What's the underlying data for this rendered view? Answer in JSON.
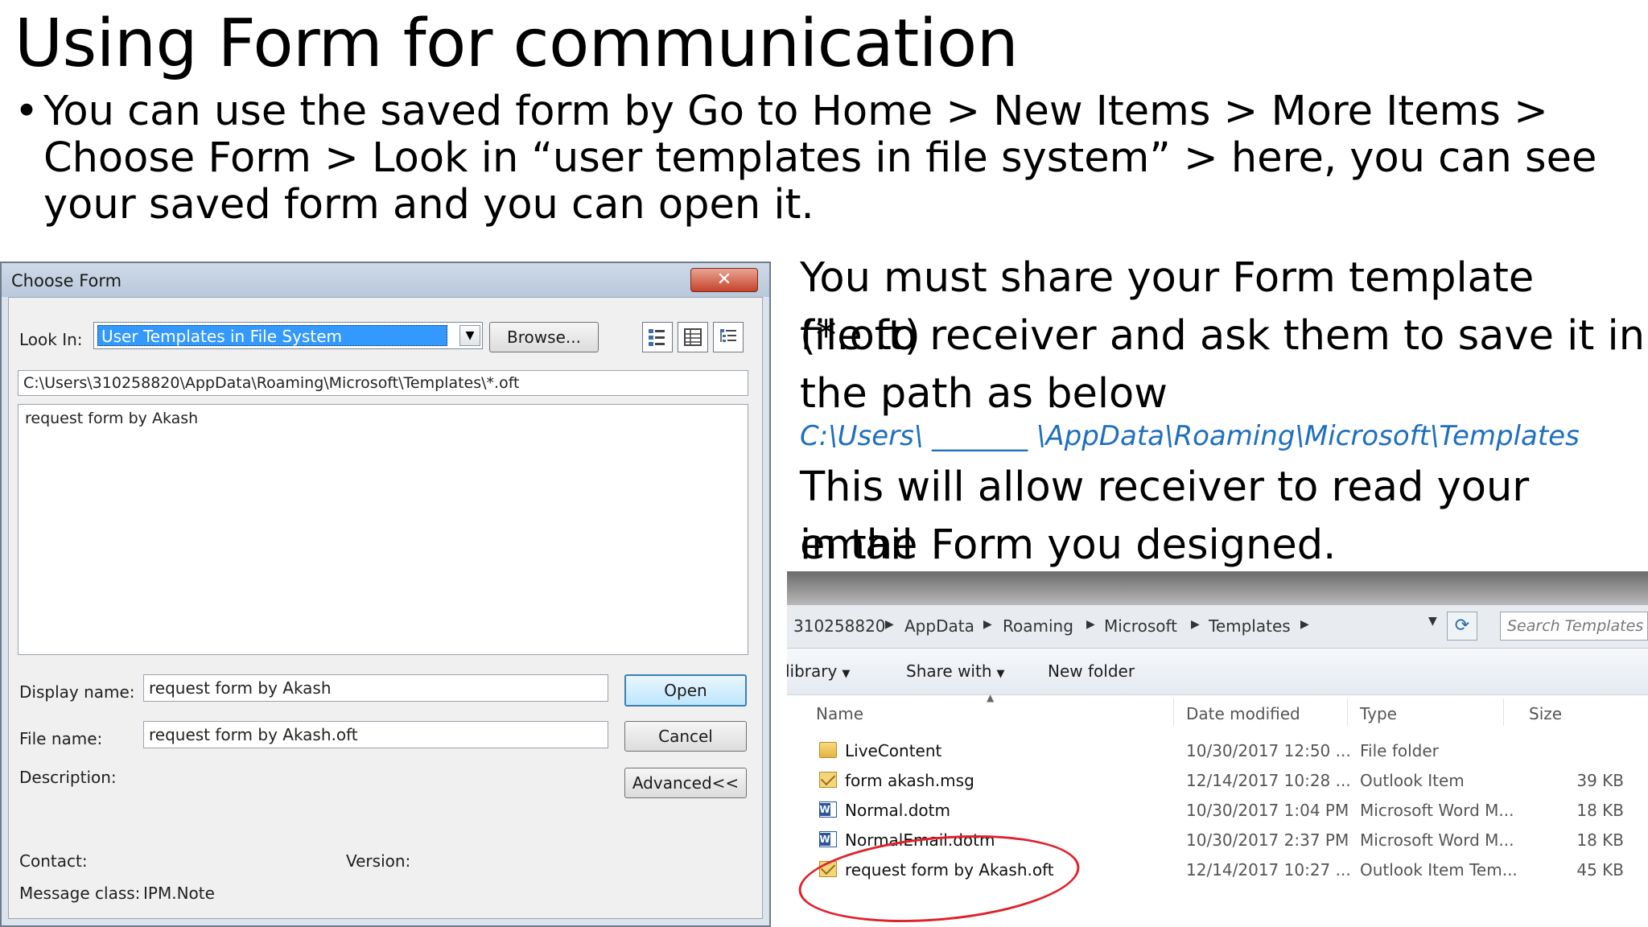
{
  "slide": {
    "title": "Using Form for communication",
    "bullet": "You can use the saved form by Go to Home > New Items > More Items > Choose Form > Look in “user templates in file system” > here, you can see your saved form and you can open it."
  },
  "dialog": {
    "title": "Choose Form",
    "close_label": "✕",
    "lookin_label": "Look In:",
    "lookin_value": "User Templates in File System",
    "browse_label": "Browse...",
    "path": "C:\\Users\\310258820\\AppData\\Roaming\\Microsoft\\Templates\\*.oft",
    "list_items": [
      "request form by Akash"
    ],
    "display_name_label": "Display name:",
    "display_name_value": "request form by Akash",
    "file_name_label": "File name:",
    "file_name_value": "request form by Akash.oft",
    "description_label": "Description:",
    "open_label": "Open",
    "cancel_label": "Cancel",
    "advanced_label": "Advanced<<",
    "contact_label": "Contact:",
    "version_label": "Version:",
    "message_class_label": "Message class:",
    "message_class_value": "IPM.Note"
  },
  "note": {
    "line1": "You must share your Form template (*.oft)",
    "line2": "file to receiver and ask them to save it in",
    "line3": "the path as below",
    "path": "C:\\Users\\ _______ \\AppData\\Roaming\\Microsoft\\Templates",
    "line4": "This will allow receiver to read your email",
    "line5": "in the Form you designed."
  },
  "explorer": {
    "breadcrumbs": [
      "310258820",
      "AppData",
      "Roaming",
      "Microsoft",
      "Templates"
    ],
    "search_placeholder": "Search Templates",
    "toolbar": {
      "library": "library",
      "share_with": "Share with",
      "new_folder": "New folder"
    },
    "columns": [
      "Name",
      "Date modified",
      "Type",
      "Size"
    ],
    "files": [
      {
        "name": "LiveContent",
        "date": "10/30/2017 12:50 ...",
        "type": "File folder",
        "size": "",
        "icon": "folder-icon"
      },
      {
        "name": "form akash.msg",
        "date": "12/14/2017 10:28 ...",
        "type": "Outlook Item",
        "size": "39 KB",
        "icon": "mail-icon"
      },
      {
        "name": "Normal.dotm",
        "date": "10/30/2017 1:04 PM",
        "type": "Microsoft Word M...",
        "size": "18 KB",
        "icon": "word-icon"
      },
      {
        "name": "NormalEmail.dotm",
        "date": "10/30/2017 2:37 PM",
        "type": "Microsoft Word M...",
        "size": "18 KB",
        "icon": "word-icon"
      },
      {
        "name": "request form by Akash.oft",
        "date": "12/14/2017 10:27 ...",
        "type": "Outlook Item Tem...",
        "size": "45 KB",
        "icon": "mail-icon"
      }
    ]
  }
}
